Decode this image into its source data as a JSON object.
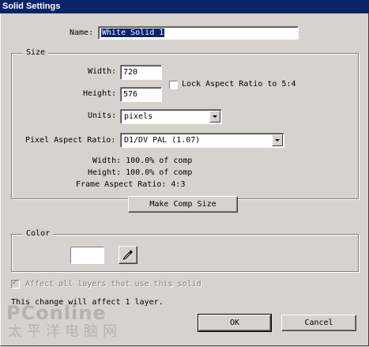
{
  "window": {
    "title": "Solid Settings"
  },
  "name": {
    "label": "Name:",
    "value": "White Solid 1"
  },
  "size": {
    "group_title": "Size",
    "width_label": "Width:",
    "width_value": "720",
    "height_label": "Height:",
    "height_value": "576",
    "lock_aspect_label": "Lock Aspect Ratio to 5:4",
    "units_label": "Units:",
    "units_value": "pixels",
    "pixel_aspect_label": "Pixel Aspect Ratio:",
    "pixel_aspect_value": "D1/DV PAL (1.07)",
    "width_percent": "Width:  100.0% of comp",
    "height_percent": "Height:  100.0% of comp",
    "frame_aspect": "Frame Aspect Ratio: 4:3",
    "make_comp_size_label": "Make Comp Size"
  },
  "color": {
    "group_title": "Color",
    "swatch_color": "#ffffff"
  },
  "affect_all_label": "Affect all layers that use this solid",
  "status_text": "This change will affect 1 layer.",
  "buttons": {
    "ok_label": "OK",
    "cancel_label": "Cancel"
  },
  "watermark": {
    "brand": "PConline",
    "chinese": "太平洋电脑网"
  }
}
